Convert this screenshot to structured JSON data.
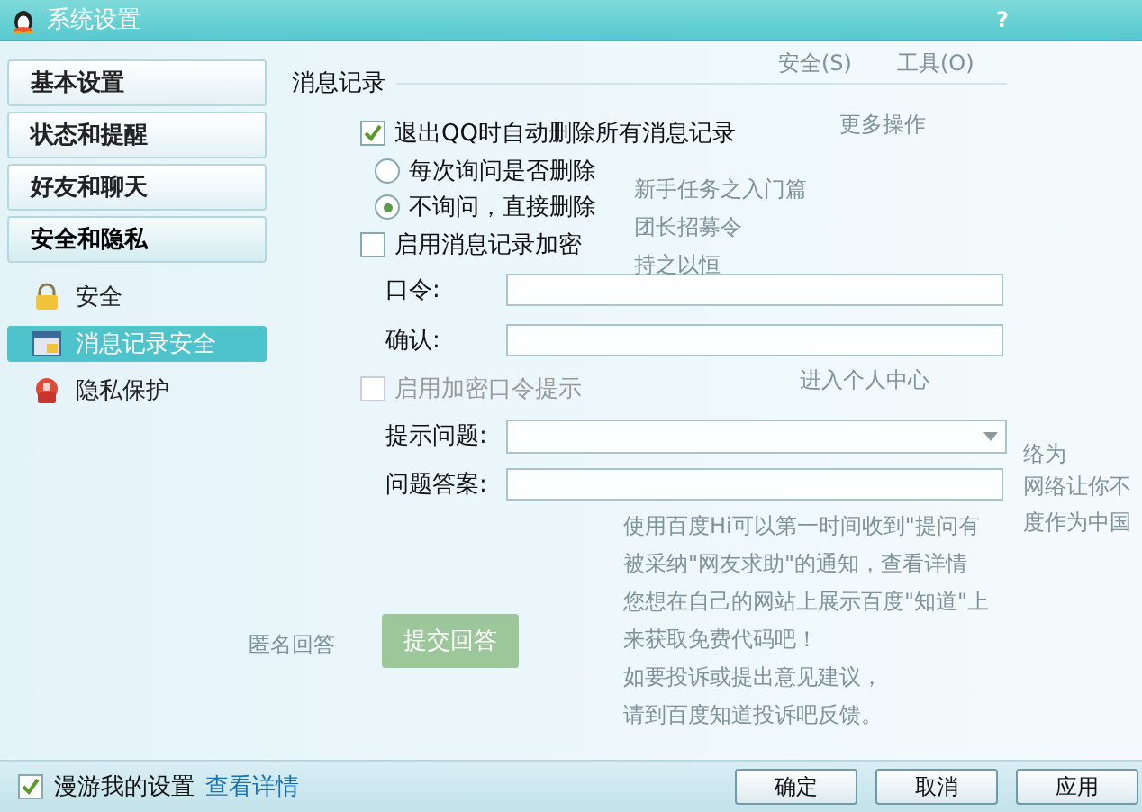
{
  "window": {
    "title": "系统设置",
    "help": "?"
  },
  "nav": [
    {
      "label": "基本设置",
      "selected": false
    },
    {
      "label": "状态和提醒",
      "selected": false
    },
    {
      "label": "好友和聊天",
      "selected": false
    },
    {
      "label": "安全和隐私",
      "selected": true
    }
  ],
  "subnav": [
    {
      "label": "安全",
      "kind": "lock",
      "selected": false
    },
    {
      "label": "消息记录安全",
      "kind": "record",
      "selected": true
    },
    {
      "label": "隐私保护",
      "kind": "privacy",
      "selected": false
    }
  ],
  "group": {
    "title": "消息记录"
  },
  "options": [
    {
      "kind": "checkbox",
      "label": "退出QQ时自动删除所有消息记录",
      "checked": true,
      "disabled": false
    },
    {
      "kind": "radio",
      "label": "每次询问是否删除",
      "selected": false
    },
    {
      "kind": "radio",
      "label": "不询问，直接删除",
      "selected": true
    },
    {
      "kind": "checkbox",
      "label": "启用消息记录加密",
      "checked": false,
      "disabled": false
    },
    {
      "kind": "field",
      "label": "口令:"
    },
    {
      "kind": "field",
      "label": "确认:"
    },
    {
      "kind": "checkbox",
      "label": "启用加密口令提示",
      "checked": false,
      "disabled": true
    },
    {
      "kind": "select",
      "label": "提示问题:"
    },
    {
      "kind": "field",
      "label": "问题答案:"
    }
  ],
  "footer": {
    "roam": {
      "label": "漫游我的设置",
      "checked": true
    },
    "link": "查看详情",
    "buttons": [
      "确定",
      "取消",
      "应用"
    ]
  },
  "background_texts": [
    "安全(S)",
    "工具(O)",
    "更多操作",
    "新手任务之入门篇",
    "团长招募令",
    "持之以恒",
    "进入个人中心",
    "使用百度Hi可以第一时间收到\"提问有",
    "被采纳\"网友求助\"的通知，查看详情",
    "您想在自己的网站上展示百度\"知道\"上",
    "来获取免费代码吧！",
    "如要投诉或提出意见建议，",
    "请到百度知道投诉吧反馈。",
    "匿名回答",
    "提交回答",
    "络为",
    "网络让你不",
    "度作为中国"
  ]
}
